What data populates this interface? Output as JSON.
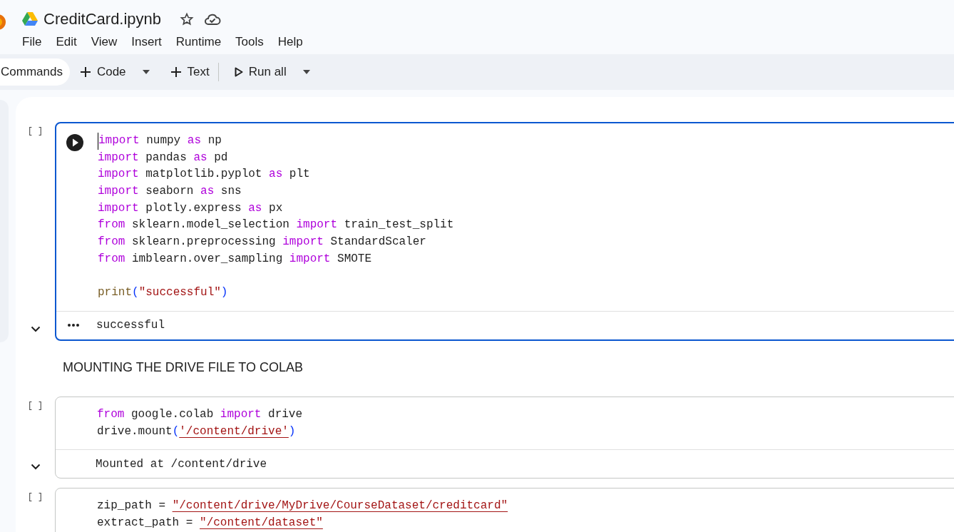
{
  "header": {
    "title": "CreditCard.ipynb",
    "menu": [
      "File",
      "Edit",
      "View",
      "Insert",
      "Runtime",
      "Tools",
      "Help"
    ]
  },
  "toolbar": {
    "commands": "Commands",
    "buttons": [
      {
        "label": "Code",
        "kind": "add",
        "dropdown": true
      },
      {
        "label": "Text",
        "kind": "add",
        "dropdown": false
      },
      {
        "label": "Run all",
        "kind": "run",
        "dropdown": true
      }
    ]
  },
  "cells": [
    {
      "kind": "code",
      "focused": true,
      "bracket": "[ ]",
      "lines": [
        {
          "kind": "code",
          "tokens": [
            {
              "t": "import",
              "kind": "kw"
            },
            {
              "t": " numpy ",
              "kind": "plain"
            },
            {
              "t": "as",
              "kind": "kw"
            },
            {
              "t": " np",
              "kind": "plain"
            }
          ]
        },
        {
          "kind": "code",
          "tokens": [
            {
              "t": "import",
              "kind": "kw"
            },
            {
              "t": " pandas ",
              "kind": "plain"
            },
            {
              "t": "as",
              "kind": "kw"
            },
            {
              "t": " pd",
              "kind": "plain"
            }
          ]
        },
        {
          "kind": "code",
          "tokens": [
            {
              "t": "import",
              "kind": "kw"
            },
            {
              "t": " matplotlib.pyplot ",
              "kind": "plain"
            },
            {
              "t": "as",
              "kind": "kw"
            },
            {
              "t": " plt",
              "kind": "plain"
            }
          ]
        },
        {
          "kind": "code",
          "tokens": [
            {
              "t": "import",
              "kind": "kw"
            },
            {
              "t": " seaborn ",
              "kind": "plain"
            },
            {
              "t": "as",
              "kind": "kw"
            },
            {
              "t": " sns",
              "kind": "plain"
            }
          ]
        },
        {
          "kind": "code",
          "tokens": [
            {
              "t": "import",
              "kind": "kw"
            },
            {
              "t": " plotly.express ",
              "kind": "plain"
            },
            {
              "t": "as",
              "kind": "kw"
            },
            {
              "t": " px",
              "kind": "plain"
            }
          ]
        },
        {
          "kind": "code",
          "tokens": [
            {
              "t": "from",
              "kind": "kw"
            },
            {
              "t": " sklearn.model_selection ",
              "kind": "plain"
            },
            {
              "t": "import",
              "kind": "kw"
            },
            {
              "t": " train_test_split",
              "kind": "plain"
            }
          ]
        },
        {
          "kind": "code",
          "tokens": [
            {
              "t": "from",
              "kind": "kw"
            },
            {
              "t": " sklearn.preprocessing ",
              "kind": "plain"
            },
            {
              "t": "import",
              "kind": "kw"
            },
            {
              "t": " StandardScaler",
              "kind": "plain"
            }
          ]
        },
        {
          "kind": "code",
          "tokens": [
            {
              "t": "from",
              "kind": "kw"
            },
            {
              "t": " imblearn.over_sampling ",
              "kind": "plain"
            },
            {
              "t": "import",
              "kind": "kw"
            },
            {
              "t": " SMOTE",
              "kind": "plain"
            }
          ]
        },
        {
          "kind": "blank"
        },
        {
          "kind": "code",
          "tokens": [
            {
              "t": "print",
              "kind": "fn"
            },
            {
              "t": "(",
              "kind": "paren"
            },
            {
              "t": "\"successful\"",
              "kind": "str"
            },
            {
              "t": ")",
              "kind": "paren"
            }
          ]
        }
      ],
      "output": "successful"
    },
    {
      "kind": "text",
      "text": "MOUNTING THE DRIVE FILE TO COLAB"
    },
    {
      "kind": "code",
      "focused": false,
      "bracket": "[ ]",
      "lines": [
        {
          "kind": "code",
          "tokens": [
            {
              "t": "from",
              "kind": "kw"
            },
            {
              "t": " google.colab ",
              "kind": "plain"
            },
            {
              "t": "import",
              "kind": "kw"
            },
            {
              "t": " drive",
              "kind": "plain"
            }
          ]
        },
        {
          "kind": "code",
          "tokens": [
            {
              "t": "drive.mount",
              "kind": "plain"
            },
            {
              "t": "(",
              "kind": "paren"
            },
            {
              "t": "'/content/drive'",
              "kind": "link"
            },
            {
              "t": ")",
              "kind": "paren"
            }
          ]
        }
      ],
      "output": "Mounted at /content/drive"
    },
    {
      "kind": "code",
      "focused": false,
      "bracket": "[ ]",
      "lines": [
        {
          "kind": "code",
          "tokens": [
            {
              "t": "zip_path = ",
              "kind": "plain"
            },
            {
              "t": "\"/content/drive/MyDrive/CourseDataset/creditcard\"",
              "kind": "link"
            }
          ]
        },
        {
          "kind": "code",
          "tokens": [
            {
              "t": "extract_path = ",
              "kind": "plain"
            },
            {
              "t": "\"/content/dataset\"",
              "kind": "link"
            }
          ]
        }
      ]
    }
  ]
}
